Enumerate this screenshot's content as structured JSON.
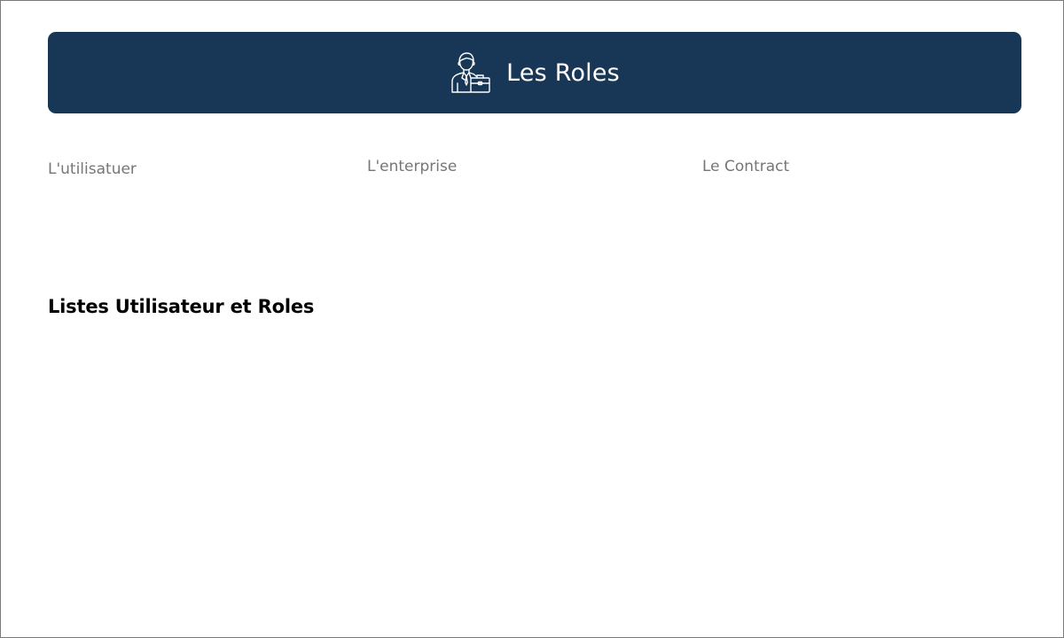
{
  "header": {
    "icon": "businessman-briefcase-icon",
    "title": "Les Roles",
    "background_color": "#183756"
  },
  "tabs": [
    {
      "label": "L'utilisatuer"
    },
    {
      "label": "L'enterprise"
    },
    {
      "label": "Le Contract"
    }
  ],
  "section": {
    "title": "Listes Utilisateur et Roles"
  }
}
